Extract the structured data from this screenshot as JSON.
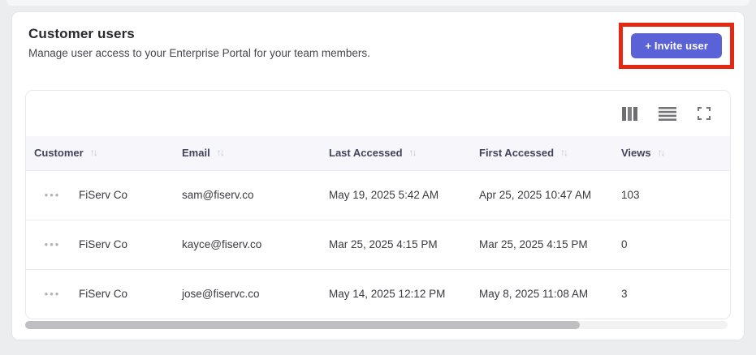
{
  "page": {
    "title": "Customer users",
    "subtitle": "Manage user access to your Enterprise Portal for your team members."
  },
  "invite_button": {
    "label": "+ Invite user",
    "bg_color": "#5a62d8"
  },
  "annotation": {
    "type": "highlight-box",
    "color": "#e52812"
  },
  "toolbar": {
    "icons": [
      "view-columns",
      "row-density",
      "fullscreen"
    ]
  },
  "table": {
    "header_bg": "#f7f7fb",
    "sort_glyph": "↑↓",
    "row_actions_glyph": "•••",
    "columns": {
      "customer": "Customer",
      "email": "Email",
      "last_accessed": "Last Accessed",
      "first_accessed": "First Accessed",
      "views": "Views"
    },
    "rows": [
      {
        "customer": "FiServ Co",
        "email": "sam@fiserv.co",
        "last_accessed": "May 19, 2025 5:42 AM",
        "first_accessed": "Apr 25, 2025 10:47 AM",
        "views": "103"
      },
      {
        "customer": "FiServ Co",
        "email": "kayce@fiserv.co",
        "last_accessed": "Mar 25, 2025 4:15 PM",
        "first_accessed": "Mar 25, 2025 4:15 PM",
        "views": "0"
      },
      {
        "customer": "FiServ Co",
        "email": "jose@fiservc.co",
        "last_accessed": "May 14, 2025 12:12 PM",
        "first_accessed": "May 8, 2025 11:08 AM",
        "views": "3"
      }
    ]
  },
  "scrollbar": {
    "thumb_style": "width:79%"
  }
}
